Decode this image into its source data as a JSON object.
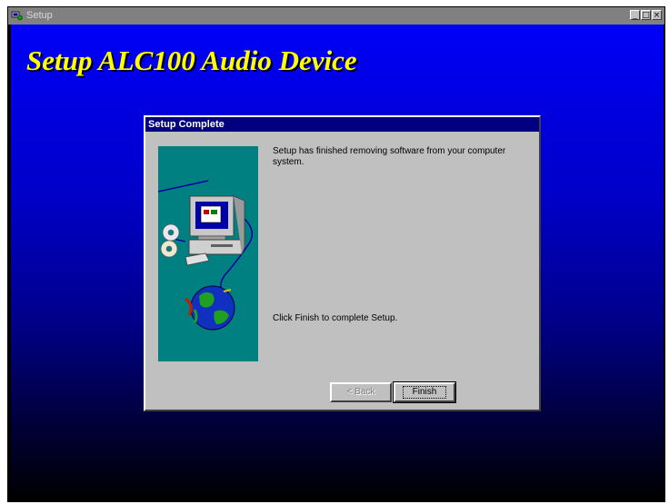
{
  "window": {
    "title": "Setup",
    "controls": [
      "_",
      "□",
      "×"
    ]
  },
  "headline": "Setup ALC100 Audio Device",
  "dialog": {
    "title": "Setup Complete",
    "message": "Setup has finished removing software from your computer system.",
    "instruction": "Click Finish to complete Setup.",
    "back_label": "< Back",
    "finish_label": "Finish"
  },
  "icons": {
    "app": "setup-icon",
    "illustration": "computer-cd-globe-illustration"
  },
  "colors": {
    "title_inactive": "#808080",
    "dialog_title": "#000080",
    "desktop_top": "#0000f8",
    "desktop_bottom": "#000000",
    "headline": "#ffff00",
    "panel": "#008080",
    "face": "#c0c0c0"
  }
}
